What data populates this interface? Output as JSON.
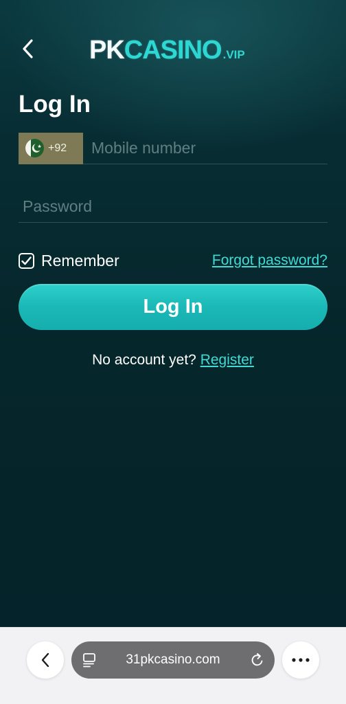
{
  "header": {
    "logo_pk": "PK",
    "logo_casino": "CASINO",
    "logo_suffix": ".VIP"
  },
  "page_title": "Log In",
  "phone": {
    "country_code": "+92",
    "flag": "pakistan-flag",
    "placeholder": "Mobile number"
  },
  "password": {
    "placeholder": "Password"
  },
  "remember": {
    "label": "Remember",
    "checked": true
  },
  "forgot_label": "Forgot password?",
  "login_button": "Log In",
  "register": {
    "prompt": "No account yet?",
    "link": "Register"
  },
  "browser": {
    "url": "31pkcasino.com"
  },
  "colors": {
    "accent": "#2fd7d2",
    "button": "#1ab8b6",
    "background": "#05262b",
    "country_code_bg": "#7d7a55"
  }
}
